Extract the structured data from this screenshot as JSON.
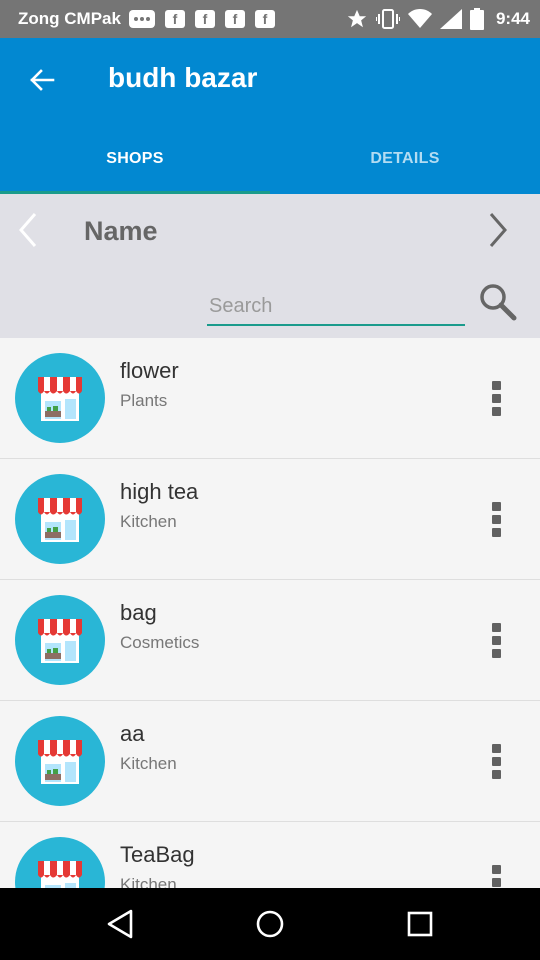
{
  "status_bar": {
    "carrier": "Zong CMPak",
    "time": "9:44",
    "icons": [
      "message-icon",
      "facebook-icon",
      "facebook-icon",
      "facebook-icon",
      "facebook-icon",
      "star-icon",
      "vibrate-icon",
      "wifi-icon",
      "signal-icon",
      "battery-icon"
    ]
  },
  "app_bar": {
    "title": "budh bazar",
    "tabs": [
      {
        "label": "SHOPS",
        "selected": true
      },
      {
        "label": "DETAILS",
        "selected": false
      }
    ]
  },
  "filter": {
    "label": "Name",
    "search_placeholder": "Search",
    "search_value": ""
  },
  "shops": [
    {
      "name": "flower",
      "category": "Plants"
    },
    {
      "name": "high tea",
      "category": "Kitchen"
    },
    {
      "name": "bag",
      "category": "Cosmetics"
    },
    {
      "name": "aa",
      "category": "Kitchen"
    },
    {
      "name": "TeaBag",
      "category": "Kitchen"
    }
  ],
  "colors": {
    "app_bar": "#0288d1",
    "accent": "#1a9b8c",
    "avatar_bg": "#29b6d6",
    "status_bar": "#757575"
  }
}
